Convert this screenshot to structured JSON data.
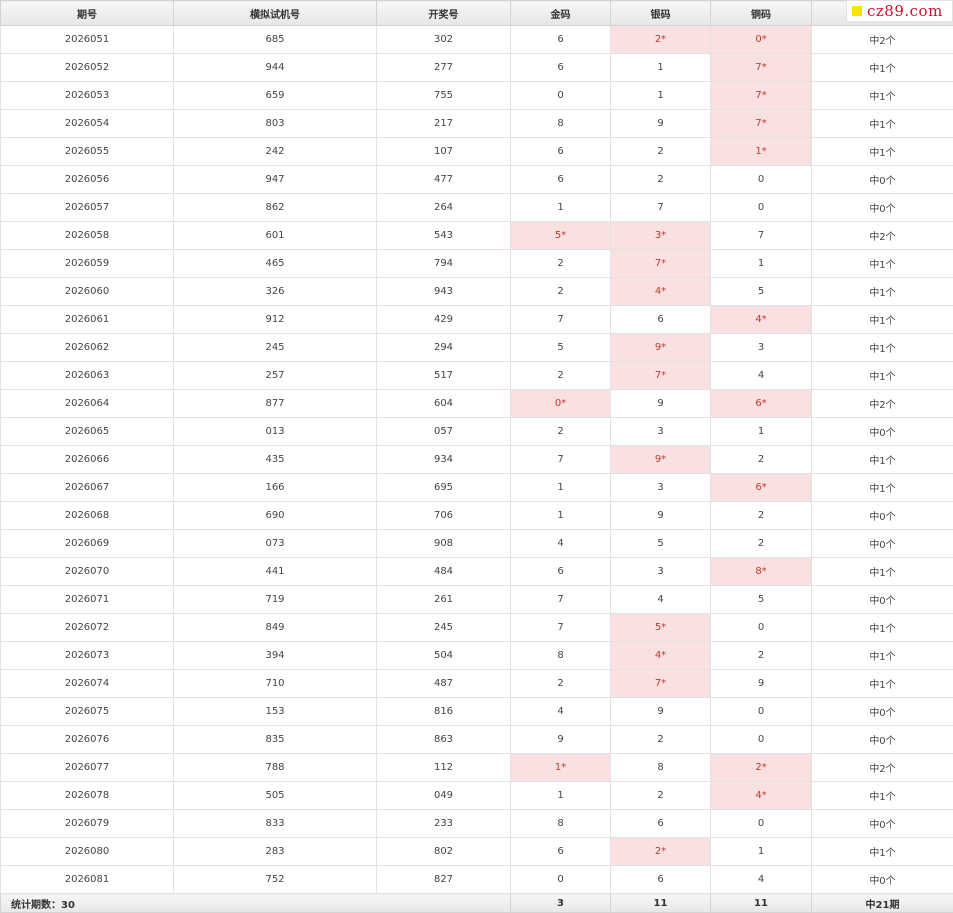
{
  "colors": {
    "hit_bg": "#f9e1e1",
    "hit_text": "#c0392b",
    "logo_text": "#c8102e",
    "logo_square": "#f6e600"
  },
  "logo": {
    "text": "cz89.com",
    "icon": "yellow-square-icon"
  },
  "headers": [
    "期号",
    "横拟试机号",
    "开奖号",
    "金码",
    "银码",
    "铜码",
    ""
  ],
  "rows": [
    [
      "2026051",
      "685",
      "302",
      "6",
      "2*",
      "0*",
      "中2个"
    ],
    [
      "2026052",
      "944",
      "277",
      "6",
      "1",
      "7*",
      "中1个"
    ],
    [
      "2026053",
      "659",
      "755",
      "0",
      "1",
      "7*",
      "中1个"
    ],
    [
      "2026054",
      "803",
      "217",
      "8",
      "9",
      "7*",
      "中1个"
    ],
    [
      "2026055",
      "242",
      "107",
      "6",
      "2",
      "1*",
      "中1个"
    ],
    [
      "2026056",
      "947",
      "477",
      "6",
      "2",
      "0",
      "中0个"
    ],
    [
      "2026057",
      "862",
      "264",
      "1",
      "7",
      "0",
      "中0个"
    ],
    [
      "2026058",
      "601",
      "543",
      "5*",
      "3*",
      "7",
      "中2个"
    ],
    [
      "2026059",
      "465",
      "794",
      "2",
      "7*",
      "1",
      "中1个"
    ],
    [
      "2026060",
      "326",
      "943",
      "2",
      "4*",
      "5",
      "中1个"
    ],
    [
      "2026061",
      "912",
      "429",
      "7",
      "6",
      "4*",
      "中1个"
    ],
    [
      "2026062",
      "245",
      "294",
      "5",
      "9*",
      "3",
      "中1个"
    ],
    [
      "2026063",
      "257",
      "517",
      "2",
      "7*",
      "4",
      "中1个"
    ],
    [
      "2026064",
      "877",
      "604",
      "0*",
      "9",
      "6*",
      "中2个"
    ],
    [
      "2026065",
      "013",
      "057",
      "2",
      "3",
      "1",
      "中0个"
    ],
    [
      "2026066",
      "435",
      "934",
      "7",
      "9*",
      "2",
      "中1个"
    ],
    [
      "2026067",
      "166",
      "695",
      "1",
      "3",
      "6*",
      "中1个"
    ],
    [
      "2026068",
      "690",
      "706",
      "1",
      "9",
      "2",
      "中0个"
    ],
    [
      "2026069",
      "073",
      "908",
      "4",
      "5",
      "2",
      "中0个"
    ],
    [
      "2026070",
      "441",
      "484",
      "6",
      "3",
      "8*",
      "中1个"
    ],
    [
      "2026071",
      "719",
      "261",
      "7",
      "4",
      "5",
      "中0个"
    ],
    [
      "2026072",
      "849",
      "245",
      "7",
      "5*",
      "0",
      "中1个"
    ],
    [
      "2026073",
      "394",
      "504",
      "8",
      "4*",
      "2",
      "中1个"
    ],
    [
      "2026074",
      "710",
      "487",
      "2",
      "7*",
      "9",
      "中1个"
    ],
    [
      "2026075",
      "153",
      "816",
      "4",
      "9",
      "0",
      "中0个"
    ],
    [
      "2026076",
      "835",
      "863",
      "9",
      "2",
      "0",
      "中0个"
    ],
    [
      "2026077",
      "788",
      "112",
      "1*",
      "8",
      "2*",
      "中2个"
    ],
    [
      "2026078",
      "505",
      "049",
      "1",
      "2",
      "4*",
      "中1个"
    ],
    [
      "2026079",
      "833",
      "233",
      "8",
      "6",
      "0",
      "中0个"
    ],
    [
      "2026080",
      "283",
      "802",
      "6",
      "2*",
      "1",
      "中1个"
    ],
    [
      "2026081",
      "752",
      "827",
      "0",
      "6",
      "4",
      "中0个"
    ]
  ],
  "footer": [
    "统计期数：30",
    "",
    "",
    "3",
    "11",
    "11",
    "中21期"
  ]
}
